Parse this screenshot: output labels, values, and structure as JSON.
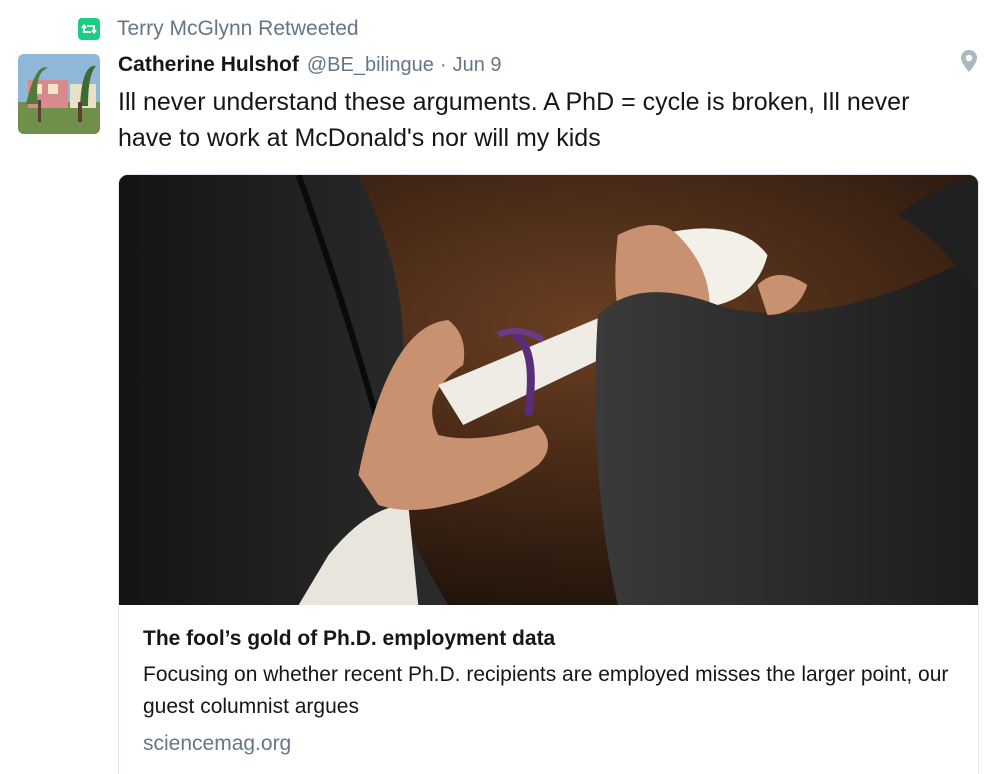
{
  "retweet": {
    "icon": "retweet-icon",
    "icon_color": "#19cf86",
    "label": "Terry McGlynn Retweeted"
  },
  "tweet": {
    "avatar_icon": "avatar",
    "author_name": "Catherine Hulshof",
    "author_handle": "@BE_bilingue",
    "separator": "·",
    "date": "Jun 9",
    "location_icon": "location-pin-icon",
    "text": "Ill never understand these arguments. A PhD = cycle is broken, Ill never have to work at McDonald's nor will my kids"
  },
  "card": {
    "image_icon": "graduation-diploma-photo",
    "title": "The fool’s gold of Ph.D. employment data",
    "description": "Focusing on whether recent Ph.D. recipients are employed misses the larger point, our guest columnist argues",
    "domain": "sciencemag.org"
  },
  "colors": {
    "secondary_text": "#657786",
    "primary_text": "#14171a",
    "border": "#e1e8ed"
  }
}
